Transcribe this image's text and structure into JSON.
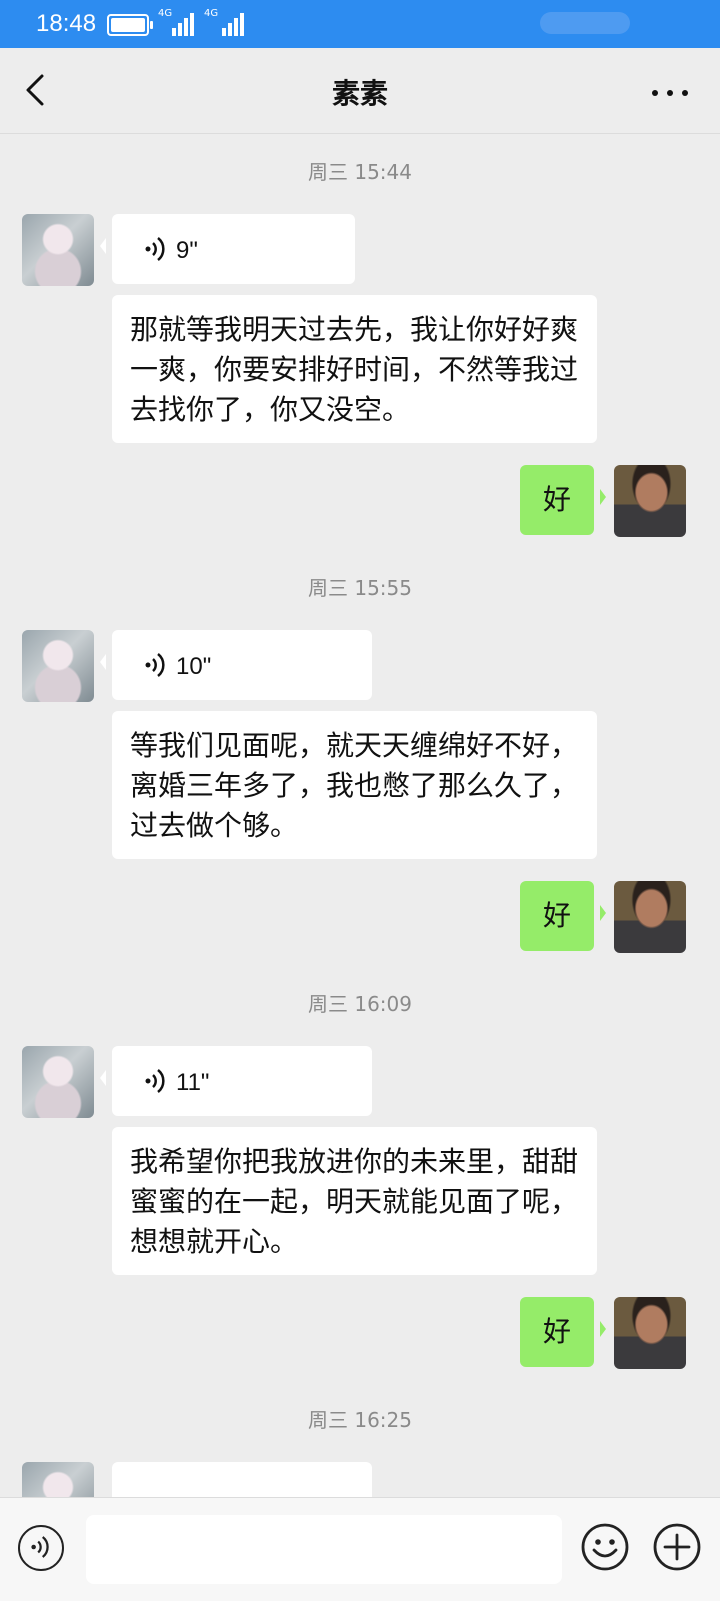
{
  "status_bar": {
    "time": "18:48",
    "network": [
      "4G",
      "4G"
    ],
    "battery_level": 0.9
  },
  "header": {
    "title": "素素"
  },
  "messages": [
    {
      "timestamp": "周三 15:44"
    },
    {
      "voice_duration": "9\""
    },
    {
      "text": "那就等我明天过去先，我让你好好爽一爽，你要安排好时间，不然等我过去找你了，你又没空。"
    },
    {
      "reply": "好"
    },
    {
      "timestamp": "周三 15:55"
    },
    {
      "voice_duration": "10\""
    },
    {
      "text": "等我们见面呢，就天天缠绵好不好，离婚三年多了，我也憋了那么久了，过去做个够。"
    },
    {
      "reply": "好"
    },
    {
      "timestamp": "周三 16:09"
    },
    {
      "voice_duration": "11\""
    },
    {
      "text": "我希望你把我放进你的未来里，甜甜蜜蜜的在一起，明天就能见面了呢，想想就开心。"
    },
    {
      "reply": "好"
    },
    {
      "timestamp": "周三 16:25"
    }
  ],
  "input": {
    "value": "",
    "placeholder": ""
  },
  "icons": {
    "back": "chevron-left-icon",
    "more": "more-dots-icon",
    "voice": "voice-icon",
    "emoji": "emoji-icon",
    "plus": "plus-icon"
  },
  "colors": {
    "status_bar": "#2d8cf0",
    "outgoing_bubble": "#95ec69",
    "incoming_bubble": "#ffffff",
    "background": "#ededed"
  }
}
